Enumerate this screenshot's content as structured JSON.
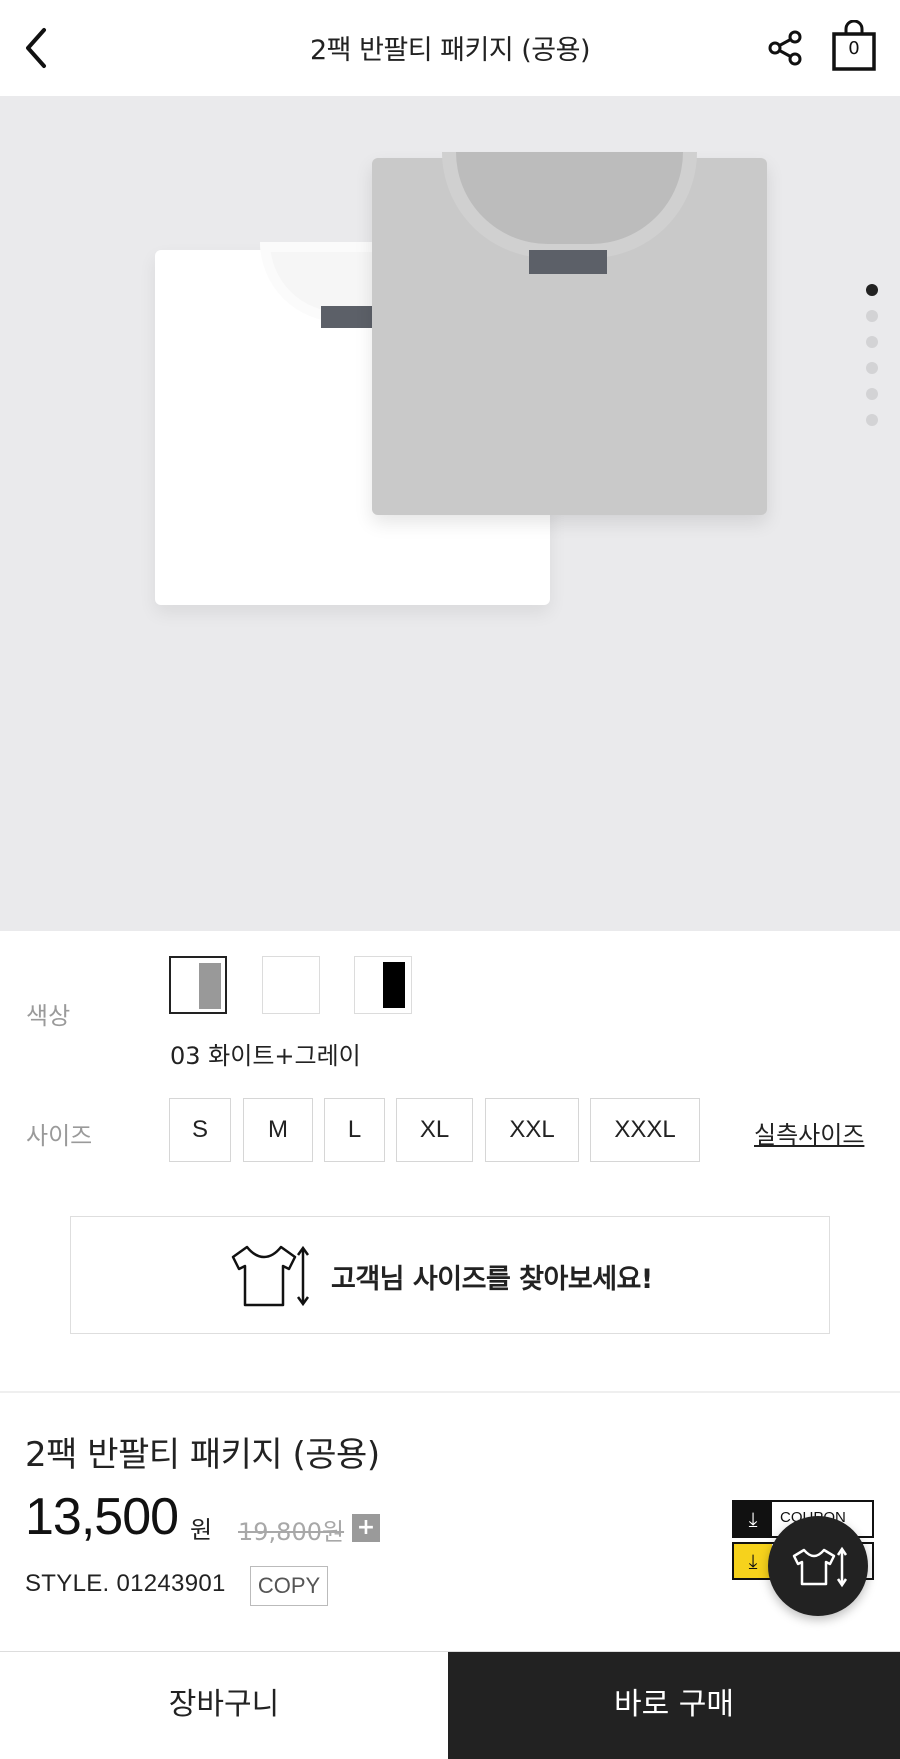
{
  "header": {
    "title": "2팩 반팔티 패키지 (공용)",
    "cart_count": "0"
  },
  "gallery": {
    "image_count": 6,
    "active_index": 0
  },
  "options": {
    "color_label": "색상",
    "selected_color_name": "03 화이트+그레이",
    "swatches": [
      {
        "left": "#ffffff",
        "right": "#999999",
        "selected": true
      },
      {
        "left": "#ffffff",
        "right": "#ffffff",
        "selected": false
      },
      {
        "left": "#ffffff",
        "right": "#000000",
        "selected": false
      }
    ],
    "size_label": "사이즈",
    "sizes": [
      "S",
      "M",
      "L",
      "XL",
      "XXL",
      "XXXL"
    ],
    "size_chart_link": "실측사이즈"
  },
  "size_finder": {
    "text": "고객님 사이즈를 찾아보세요!"
  },
  "product": {
    "name": "2팩 반팔티 패키지 (공용)",
    "price": "13,500",
    "price_unit": "원",
    "original_price": "19,800원",
    "plus_label": "+",
    "style_code": "STYLE. 01243901",
    "copy_label": "COPY",
    "coupon_label": "COUPON"
  },
  "bottom_bar": {
    "cart_label": "장바구니",
    "buy_label": "바로 구매"
  },
  "colors": {
    "accent_dark": "#222222",
    "coupon_yellow": "#f6d21c",
    "gallery_bg": "#eaeaec"
  }
}
